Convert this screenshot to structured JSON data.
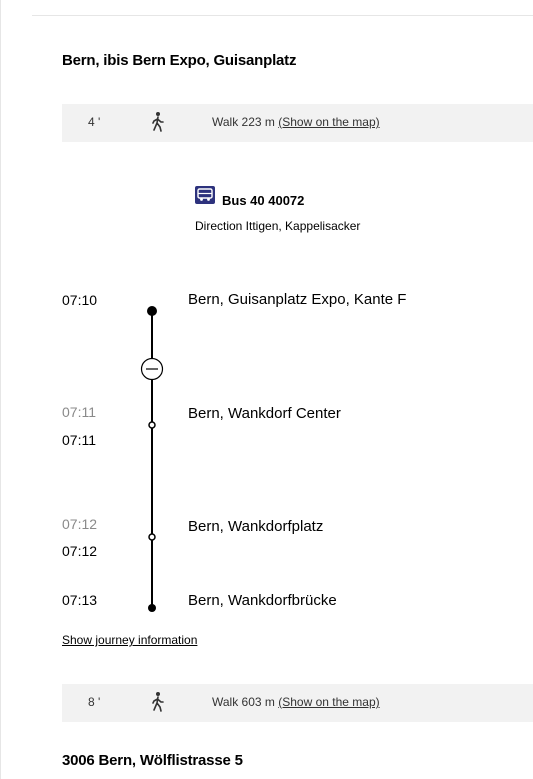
{
  "origin_title": "Bern, ibis Bern Expo, Guisanplatz",
  "walk1": {
    "minutes": "4 '",
    "text": "Walk 223 m ",
    "link": "(Show on the map)"
  },
  "bus": {
    "icon": "bus-icon",
    "label": "Bus 40 40072",
    "direction": "Direction Ittigen, Kappelisacker",
    "icon_color": "#2d327d"
  },
  "stops": [
    {
      "time": "07:10",
      "name": "Bern, Guisanplatz Expo, Kante F"
    },
    {
      "scheduled": "07:11",
      "actual": "07:11",
      "name": "Bern, Wankdorf Center"
    },
    {
      "scheduled": "07:12",
      "actual": "07:12",
      "name": "Bern, Wankdorfplatz"
    },
    {
      "time": "07:13",
      "name": "Bern, Wankdorfbrücke"
    }
  ],
  "collapse_icon": "minus-circle-icon",
  "journey_link": "Show journey information",
  "walk2": {
    "minutes": "8 '",
    "text": "Walk 603 m ",
    "link": "(Show on the map)"
  },
  "destination_title": "3006 Bern, Wölflistrasse 5"
}
